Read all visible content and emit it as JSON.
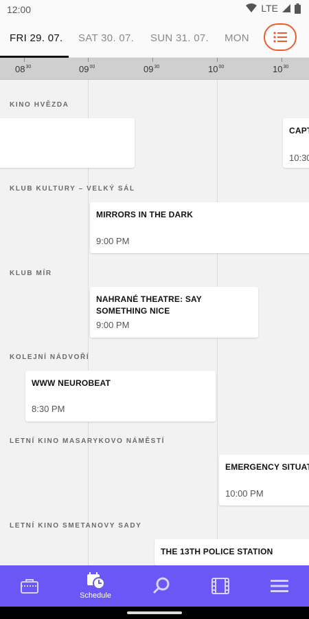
{
  "status_bar": {
    "time": "12:00",
    "network": "LTE"
  },
  "days": [
    {
      "label": "FRI 29. 07.",
      "active": true
    },
    {
      "label": "SAT 30. 07.",
      "active": false
    },
    {
      "label": "SUN 31. 07.",
      "active": false
    },
    {
      "label": "MON",
      "active": false
    }
  ],
  "ruler": [
    {
      "hour": "08",
      "min": "30"
    },
    {
      "hour": "09",
      "min": "00"
    },
    {
      "hour": "09",
      "min": "30"
    },
    {
      "hour": "10",
      "min": "00"
    },
    {
      "hour": "10",
      "min": "30"
    }
  ],
  "venues": [
    "KINO HVĚZDA",
    "KLUB KULTURY – VELKÝ SÁL",
    "KLUB MÍR",
    "KOLEJNÍ NÁDVOŘÍ",
    "LETNÍ KINO MASARYKOVO NÁMĚSTÍ",
    "LETNÍ KINO SMETANOVY SADY"
  ],
  "events": [
    {
      "title": "",
      "time": ""
    },
    {
      "title": "CAPT",
      "time": "10:30"
    },
    {
      "title": "MIRRORS IN THE DARK",
      "time": "9:00 PM"
    },
    {
      "title": "NAHRANÉ THEATRE: SAY SOMETHING NICE",
      "time": "9:00 PM"
    },
    {
      "title": "WWW NEUROBEAT",
      "time": "8:30 PM"
    },
    {
      "title": "EMERGENCY SITUATIO",
      "time": "10:00 PM"
    },
    {
      "title": "THE 13TH POLICE STATION",
      "time": ""
    }
  ],
  "bottom_nav": [
    {
      "icon": "ticket-icon",
      "label": ""
    },
    {
      "icon": "calendar-clock-icon",
      "label": "Schedule"
    },
    {
      "icon": "search-icon",
      "label": ""
    },
    {
      "icon": "film-icon",
      "label": ""
    },
    {
      "icon": "menu-icon",
      "label": ""
    }
  ],
  "colors": {
    "accent": "#ef5a2a",
    "nav": "#6a57f6"
  }
}
